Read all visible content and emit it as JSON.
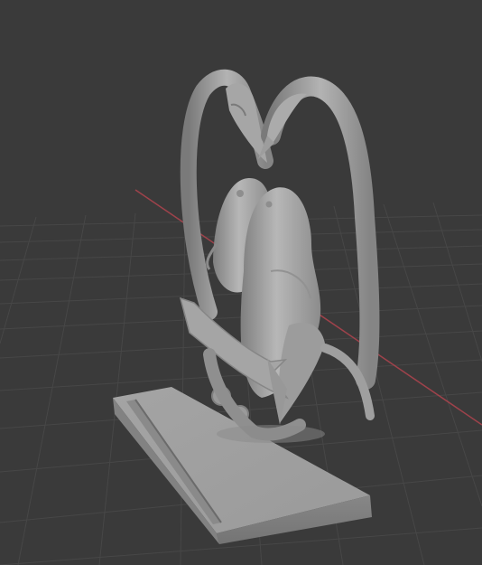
{
  "viewport": {
    "name": "3d-viewport",
    "background": "#3a3a3a",
    "grid_color": "#4a4a4a",
    "x_axis_color": "#b0444e",
    "model_color": "#a9a9a9"
  },
  "model": {
    "name": "sculpture-two-birds-heart",
    "parts": [
      "base-plate",
      "base-slot",
      "left-bird",
      "right-bird",
      "left-neck",
      "right-neck",
      "banner",
      "scroll-curls"
    ]
  }
}
